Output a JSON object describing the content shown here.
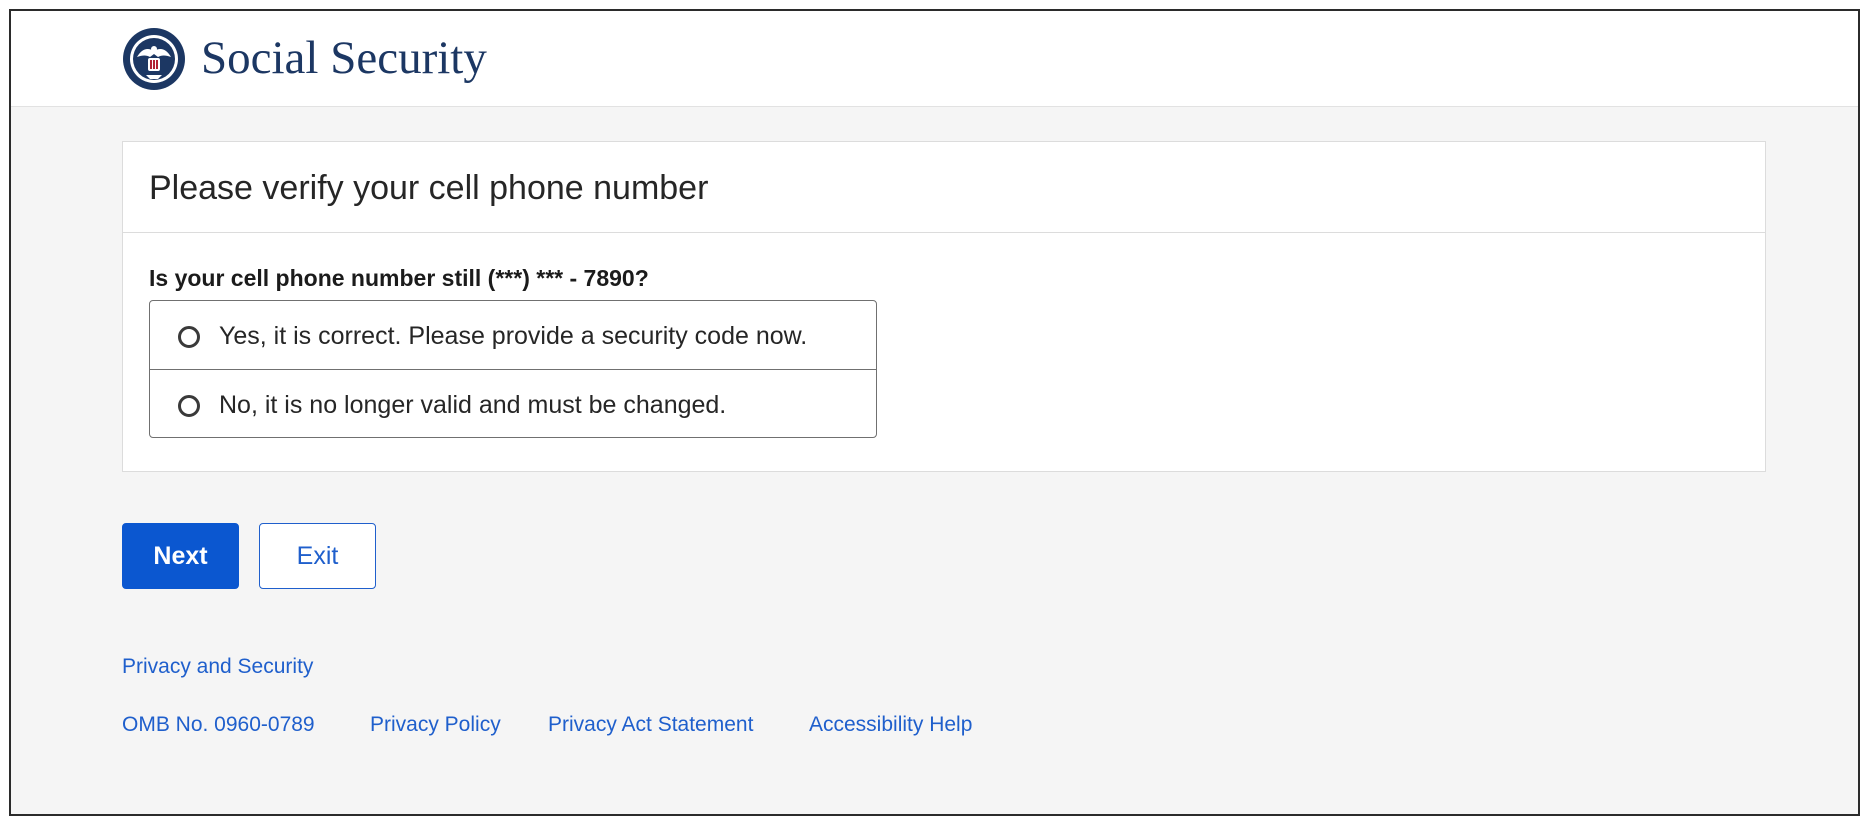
{
  "header": {
    "brand": "Social Security",
    "seal_icon": "ssa-seal-icon"
  },
  "card": {
    "title": "Please verify your cell phone number",
    "question": "Is your cell phone number still (***) *** - 7890?",
    "options": [
      {
        "label": "Yes, it is correct. Please provide a security code now.",
        "selected": false
      },
      {
        "label": "No, it is no longer valid and must be changed.",
        "selected": false
      }
    ]
  },
  "actions": {
    "next_label": "Next",
    "exit_label": "Exit"
  },
  "footer": {
    "privacy_security": "Privacy and Security",
    "omb": "OMB No. 0960-0789",
    "links": [
      "Privacy Policy",
      "Privacy Act Statement",
      "Accessibility Help"
    ]
  },
  "colors": {
    "primary": "#0b57d0",
    "link": "#1f5fcc",
    "brand_text": "#1c3763",
    "page_bg": "#f5f5f5"
  }
}
